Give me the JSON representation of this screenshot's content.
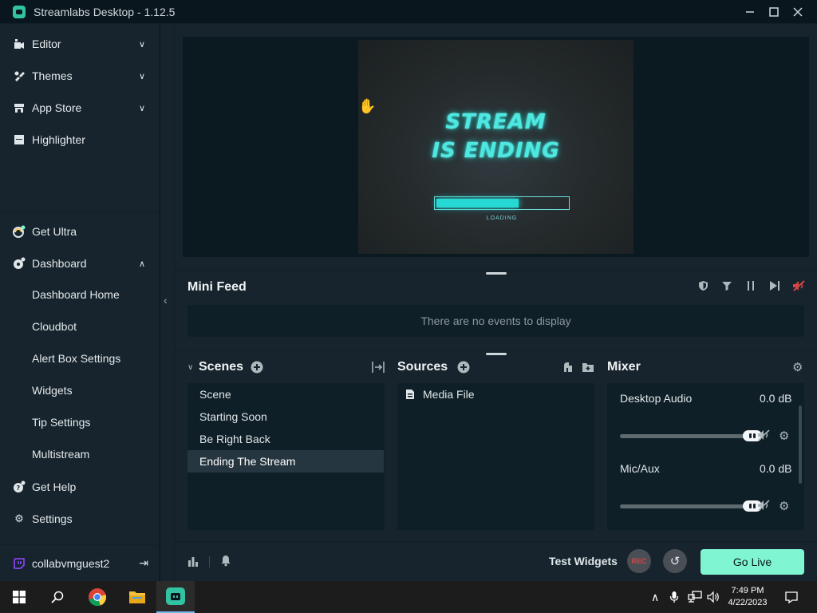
{
  "window": {
    "title": "Streamlabs Desktop - 1.12.5"
  },
  "window_controls": [
    "minimize",
    "maximize",
    "close"
  ],
  "sidebar": {
    "top_items": [
      {
        "label": "Editor",
        "icon": "editor-icon"
      },
      {
        "label": "Themes",
        "icon": "themes-icon"
      },
      {
        "label": "App Store",
        "icon": "store-icon"
      },
      {
        "label": "Highlighter",
        "icon": "highlighter-icon"
      }
    ],
    "get_ultra": "Get Ultra",
    "dashboard": "Dashboard",
    "dashboard_subitems": [
      "Dashboard Home",
      "Cloudbot",
      "Alert Box Settings",
      "Widgets",
      "Tip Settings",
      "Multistream"
    ],
    "get_help": "Get Help",
    "settings": "Settings",
    "user": "collabvmguest2"
  },
  "preview": {
    "line1": "STREAM",
    "line2": "IS ENDING",
    "loading": "LOADING",
    "progress_fraction": 0.63
  },
  "mini_feed": {
    "title": "Mini Feed",
    "empty": "There are no events to display"
  },
  "scenes": {
    "title": "Scenes",
    "items": [
      "Scene",
      "Starting Soon",
      "Be Right Back",
      "Ending The Stream"
    ],
    "selected_index": 3
  },
  "sources": {
    "title": "Sources",
    "items": [
      "Media File"
    ]
  },
  "mixer": {
    "title": "Mixer",
    "channels": [
      {
        "name": "Desktop Audio",
        "db": "0.0 dB",
        "level": 1.0
      },
      {
        "name": "Mic/Aux",
        "db": "0.0 dB",
        "level": 1.0
      }
    ]
  },
  "footer": {
    "test_widgets": "Test Widgets",
    "rec": "REC",
    "go_live": "Go Live"
  },
  "taskbar": {
    "time": "7:49 PM",
    "date": "4/22/2023"
  },
  "colors": {
    "accent": "#80f5d2",
    "panel": "#17242d",
    "background": "#09161d",
    "rec": "#d64545",
    "neon": "#27d9d5"
  }
}
